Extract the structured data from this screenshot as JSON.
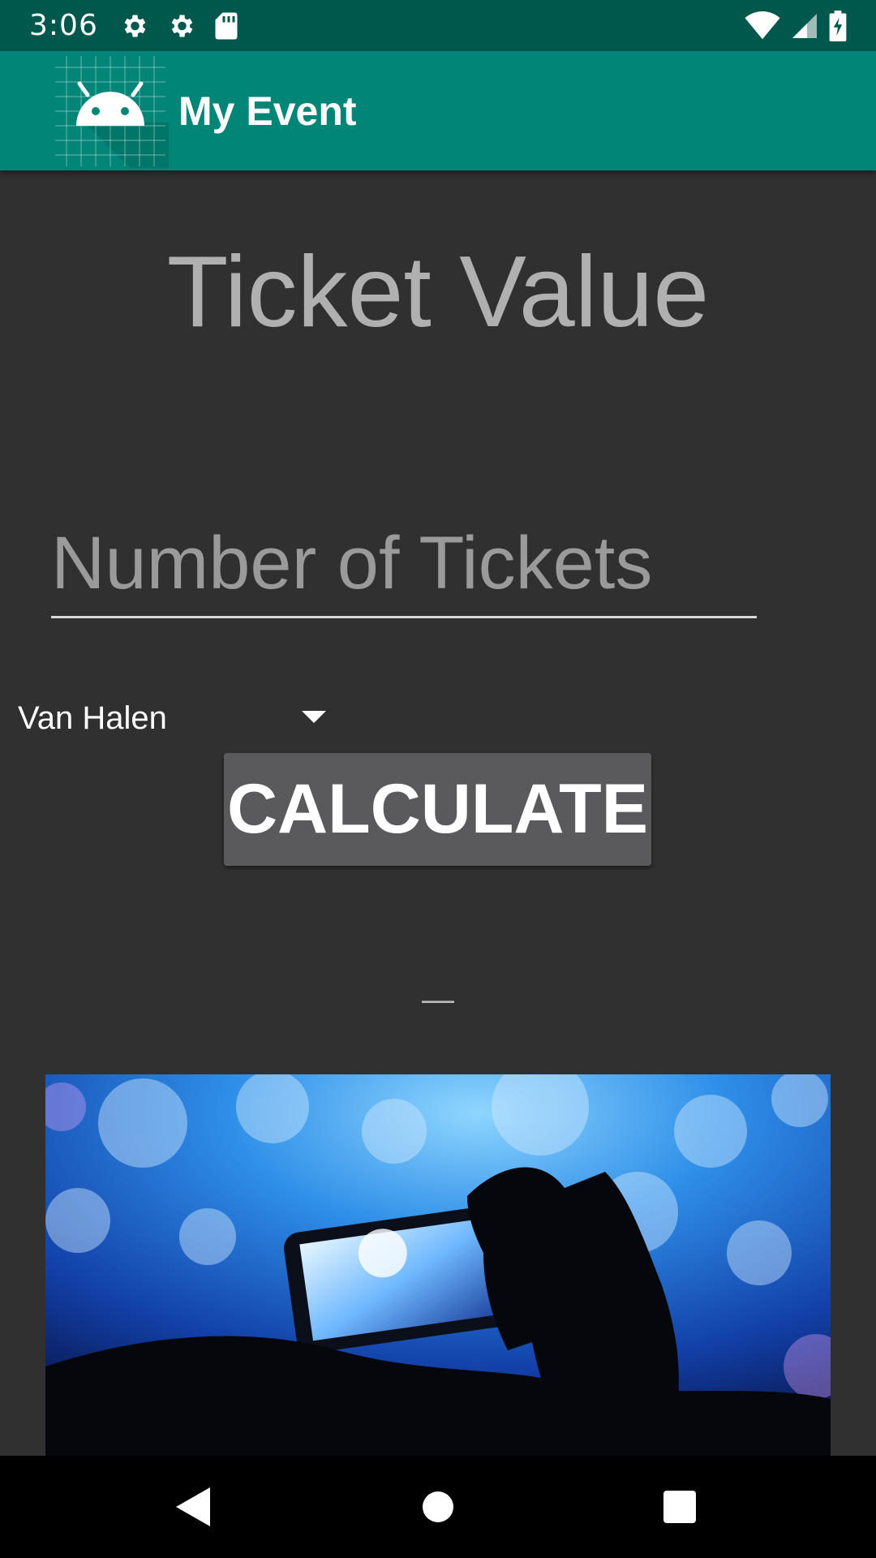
{
  "status_bar": {
    "time": "3:06",
    "left_icons": [
      "gear-icon",
      "gear-icon",
      "sd-card-icon"
    ],
    "right_icons": [
      "wifi-icon",
      "signal-icon",
      "battery-charging-icon"
    ]
  },
  "app_bar": {
    "title": "My Event",
    "logo_icon": "android-robot-icon",
    "color": "#008577"
  },
  "main": {
    "heading": "Ticket Value",
    "tickets_input": {
      "value": "",
      "placeholder": "Number of Tickets"
    },
    "band_spinner": {
      "selected": "Van Halen"
    },
    "calculate_label": "CALCULATE",
    "result_text": "—",
    "photo_icon": "concert-phone-photo"
  },
  "nav_bar": {
    "buttons": [
      "back-icon",
      "home-icon",
      "recents-icon"
    ]
  },
  "colors": {
    "status_bar": "#00574B",
    "app_bar": "#008577",
    "background": "#303030",
    "button": "#5A5A5C"
  }
}
